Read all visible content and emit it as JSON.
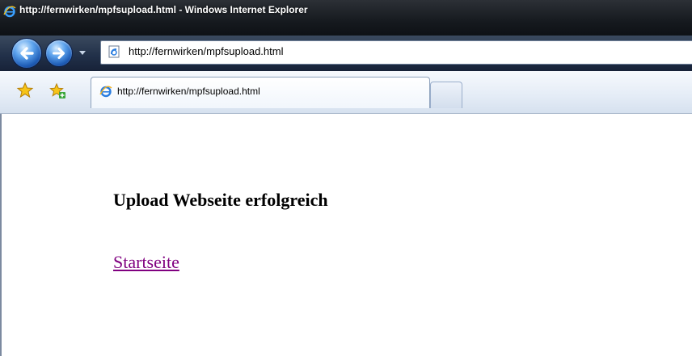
{
  "window": {
    "title": "http://fernwirken/mpfsupload.html - Windows Internet Explorer"
  },
  "navigation": {
    "address": "http://fernwirken/mpfsupload.html"
  },
  "tabs": [
    {
      "label": "http://fernwirken/mpfsupload.html"
    }
  ],
  "page": {
    "heading": "Upload Webseite erfolgreich",
    "link_label": "Startseite"
  },
  "colors": {
    "visited_link": "#800080",
    "titlebar": "#161a1f"
  },
  "icons": {
    "title": "ie-icon",
    "back": "back-arrow-icon",
    "forward": "forward-arrow-icon",
    "history": "chevron-down-icon",
    "address": "page-icon",
    "favorites": "favorites-star-icon",
    "add_favorite": "add-favorite-icon",
    "tab": "ie-icon"
  }
}
